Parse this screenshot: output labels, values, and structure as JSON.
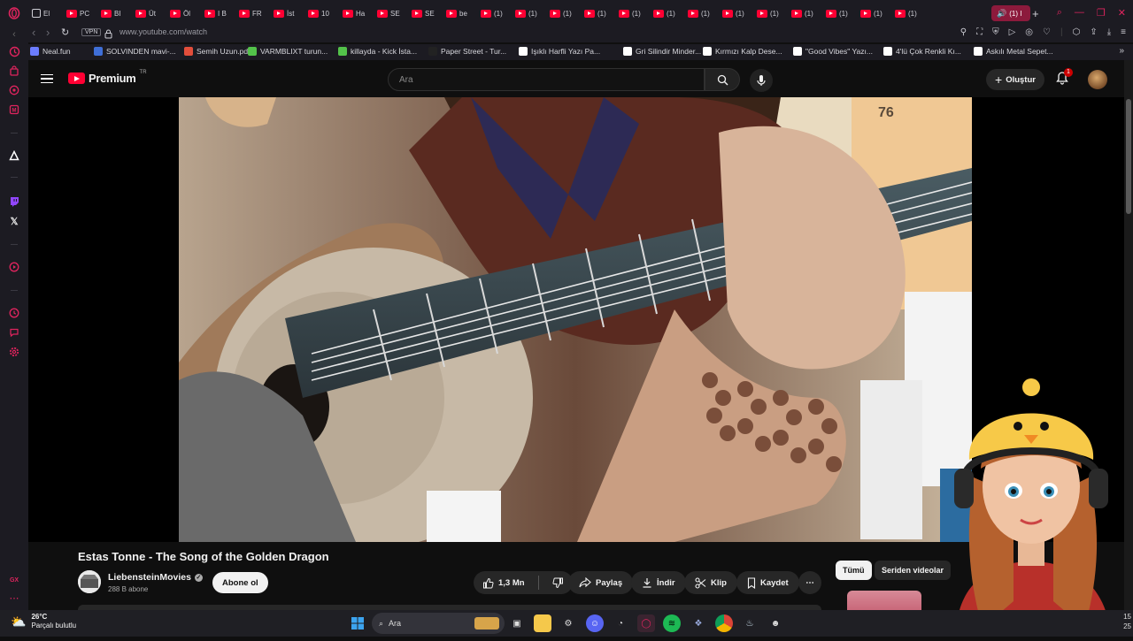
{
  "browser": {
    "tabs": [
      {
        "label": "El",
        "favicon": "app"
      },
      {
        "label": "PC",
        "favicon": "youtube"
      },
      {
        "label": "BI",
        "favicon": "youtube"
      },
      {
        "label": "Üt",
        "favicon": "youtube"
      },
      {
        "label": "Öl",
        "favicon": "youtube"
      },
      {
        "label": "I B",
        "favicon": "youtube"
      },
      {
        "label": "FR",
        "favicon": "youtube"
      },
      {
        "label": "İst",
        "favicon": "youtube"
      },
      {
        "label": "10",
        "favicon": "youtube"
      },
      {
        "label": "Ha",
        "favicon": "youtube"
      },
      {
        "label": "SE",
        "favicon": "youtube"
      },
      {
        "label": "SE",
        "favicon": "youtube"
      },
      {
        "label": "be",
        "favicon": "youtube"
      },
      {
        "label": "(1)",
        "favicon": "youtube"
      },
      {
        "label": "(1)",
        "favicon": "youtube"
      },
      {
        "label": "(1)",
        "favicon": "youtube"
      },
      {
        "label": "(1)",
        "favicon": "youtube"
      },
      {
        "label": "(1)",
        "favicon": "youtube"
      },
      {
        "label": "(1)",
        "favicon": "youtube"
      },
      {
        "label": "(1)",
        "favicon": "youtube"
      },
      {
        "label": "(1)",
        "favicon": "youtube"
      },
      {
        "label": "(1)",
        "favicon": "youtube"
      },
      {
        "label": "(1)",
        "favicon": "youtube"
      },
      {
        "label": "(1)",
        "favicon": "youtube"
      },
      {
        "label": "(1)",
        "favicon": "youtube"
      },
      {
        "label": "(1)",
        "favicon": "youtube"
      }
    ],
    "active_tab_label": "(1) I",
    "new_tab_label": "+",
    "vpn_label": "VPN",
    "url": "www.youtube.com/watch",
    "bookmarks": [
      "Neal.fun",
      "SOLVINDEN mavi-...",
      "Semih Uzun.pdf",
      "VARMBLIXT turun...",
      "killayda - Kick İsta...",
      "Paper Street - Tur...",
      "Işıklı Harfli Yazı Pa...",
      "Gri Silindir Minder...",
      "Kırmızı Kalp Dese...",
      "\"Good Vibes\" Yazı...",
      "4'lü Çok Renkli Kı...",
      "Askılı Metal Sepet..."
    ],
    "sidebar_badge": "GX",
    "accent_color": "#e0245e"
  },
  "youtube": {
    "logo_text": "Premium",
    "logo_region": "TR",
    "search_placeholder": "Ara",
    "create_label": "Oluştur",
    "notification_count": "1",
    "video": {
      "title": "Estas Tonne - The Song of the Golden Dragon",
      "channel_name": "LiebensteinMovies",
      "subscribers": "288 B abone",
      "subscribe_label": "Abone ol",
      "likes": "1,3 Mn",
      "share_label": "Paylaş",
      "download_label": "İndir",
      "clip_label": "Klip",
      "save_label": "Kaydet",
      "more_label": "⋯",
      "overlay_number": "76"
    },
    "chips": [
      "Tümü",
      "Seriden videolar"
    ]
  },
  "taskbar": {
    "weather_temp": "26°C",
    "weather_desc": "Parçalı bulutlu",
    "search_label": "Ara",
    "clock_line1": "15",
    "clock_line2": "25"
  }
}
